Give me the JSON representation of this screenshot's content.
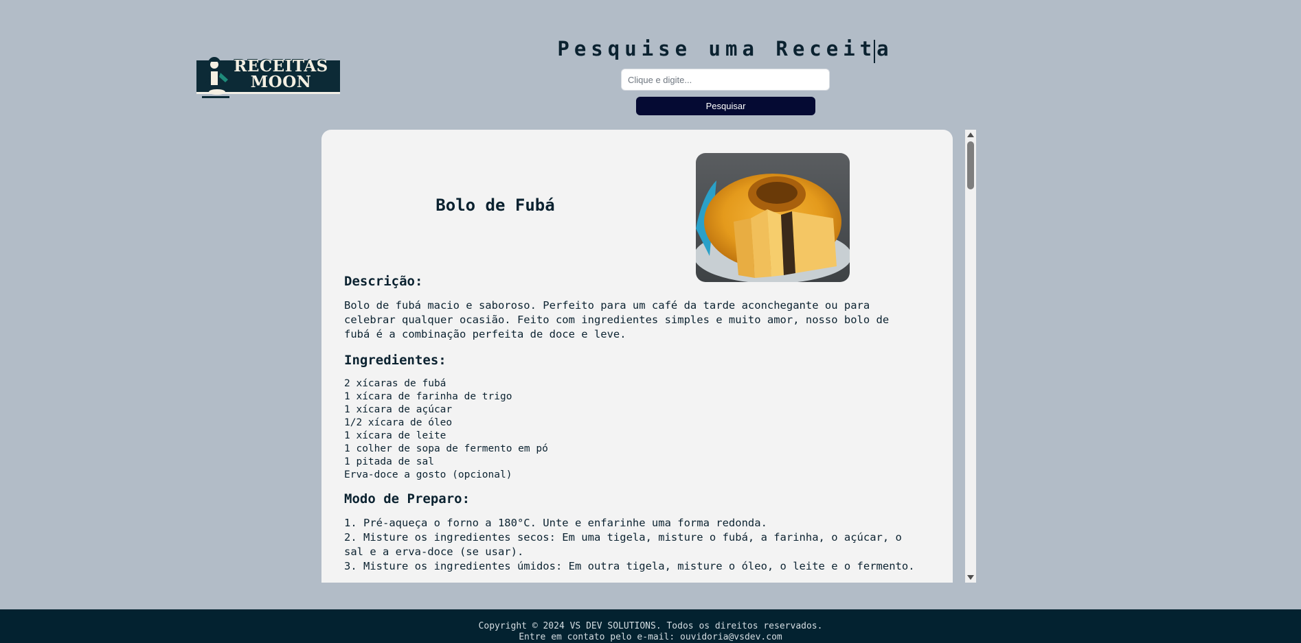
{
  "header": {
    "logo_alt": "RECEITAS MOON",
    "logo_line1": "RECEITAS",
    "logo_line2": "MOON",
    "search_title": "Pesquise uma Receita",
    "search_placeholder": "Clique e digite...",
    "search_button_label": "Pesquisar"
  },
  "recipe": {
    "title": "Bolo de Fubá",
    "photo_alt": "Bolo de Fubá",
    "description_heading": "Descrição:",
    "description_lines": [
      "Bolo de fubá macio e saboroso. Perfeito para um café da tarde aconchegante ou para",
      "celebrar qualquer ocasião. Feito com ingredientes simples e muito amor, nosso bolo de",
      "fubá é a combinação perfeita de doce e leve."
    ],
    "ingredients_heading": "Ingredientes:",
    "ingredients": [
      "2 xícaras de fubá",
      "1 xícara de farinha de trigo",
      "1 xícara de açúcar",
      "1/2 xícara de óleo",
      "1 xícara de leite",
      "1 colher de sopa de fermento em pó",
      "1 pitada de sal",
      "Erva-doce a gosto (opcional)"
    ],
    "preparation_heading": "Modo de Preparo:",
    "steps": [
      "1. Pré-aqueça o forno a 180°C. Unte e enfarinhe uma forma redonda.",
      "2. Misture os ingredientes secos: Em uma tigela, misture o fubá, a farinha, o açúcar, o",
      "sal e a erva-doce (se usar).",
      "3. Misture os ingredientes úmidos: Em outra tigela, misture o óleo, o leite e o fermento."
    ]
  },
  "footer": {
    "copyright": "Copyright © 2024 VS DEV SOLUTIONS. Todos os direitos reservados.",
    "contact": "Entre em contato pelo e-mail: ouvidoria@vsdev.com"
  },
  "colors": {
    "page_background": "#b2bcc7",
    "card_background": "#f3f3f3",
    "button_background": "#050a33",
    "footer_background": "#032230",
    "text_primary": "#0b2230"
  }
}
